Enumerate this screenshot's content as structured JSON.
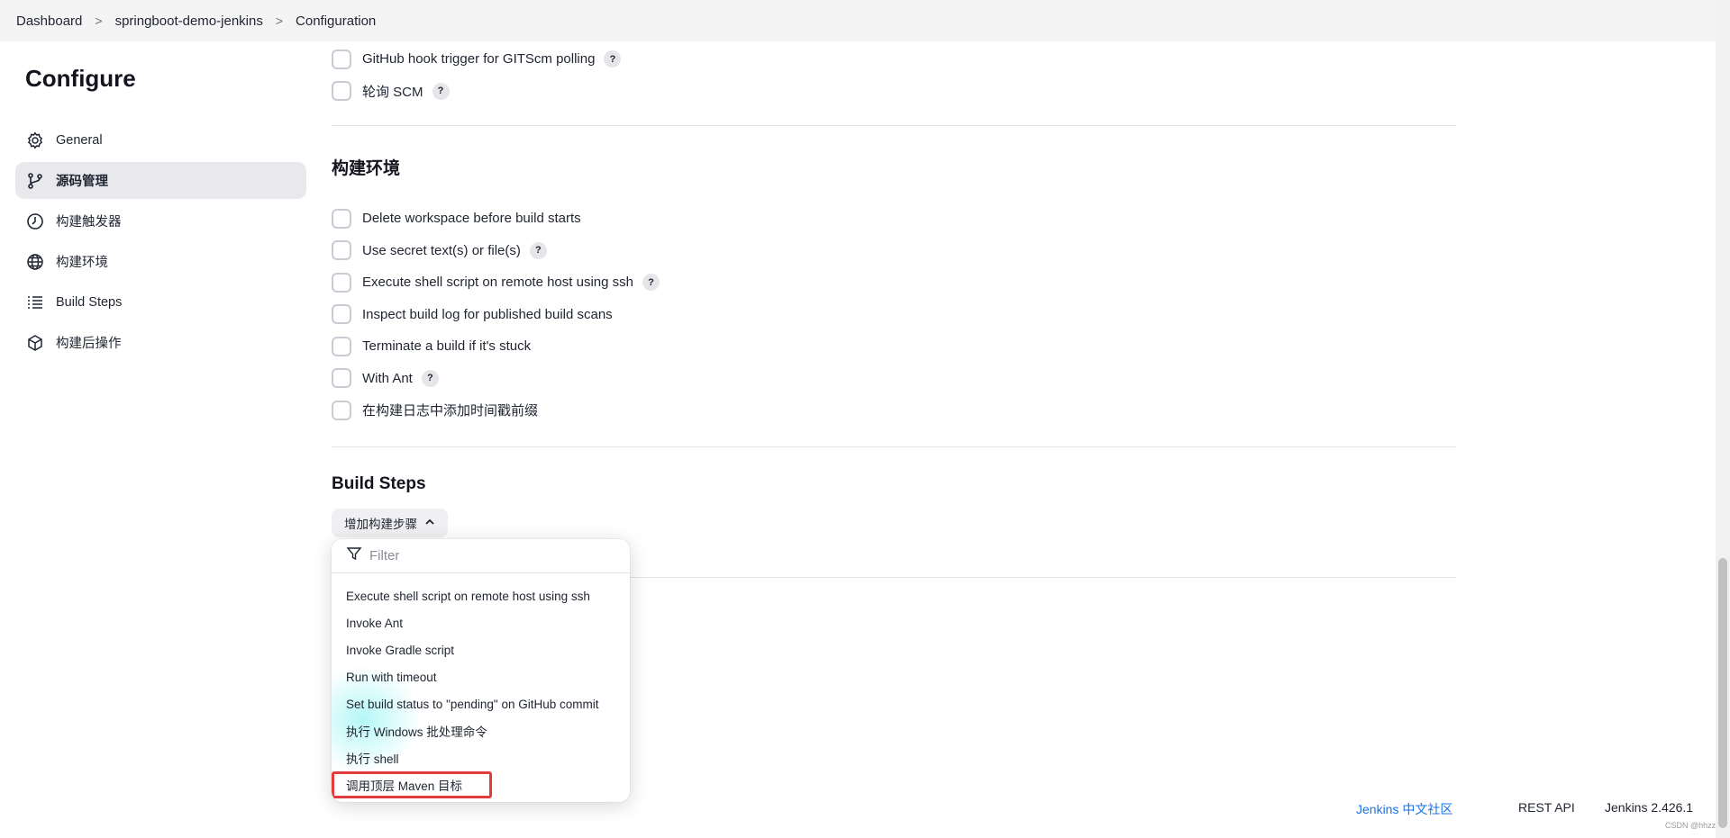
{
  "breadcrumb": {
    "items": [
      "Dashboard",
      "springboot-demo-jenkins",
      "Configuration"
    ],
    "separator": ">"
  },
  "sidebar": {
    "title": "Configure",
    "items": [
      {
        "label": "General",
        "icon": "gear-icon",
        "active": false
      },
      {
        "label": "源码管理",
        "icon": "branch-icon",
        "active": true
      },
      {
        "label": "构建触发器",
        "icon": "timer-icon",
        "active": false
      },
      {
        "label": "构建环境",
        "icon": "globe-icon",
        "active": false
      },
      {
        "label": "Build Steps",
        "icon": "list-icon",
        "active": false
      },
      {
        "label": "构建后操作",
        "icon": "cube-icon",
        "active": false
      }
    ]
  },
  "triggers": {
    "options": [
      {
        "label": "GitHub hook trigger for GITScm polling",
        "help": "?",
        "checked": false
      },
      {
        "label": "轮询 SCM",
        "help": "?",
        "checked": false
      }
    ]
  },
  "build_env": {
    "title": "构建环境",
    "options": [
      {
        "label": "Delete workspace before build starts",
        "help": "",
        "checked": false
      },
      {
        "label": "Use secret text(s) or file(s)",
        "help": "?",
        "checked": false
      },
      {
        "label": "Execute shell script on remote host using ssh",
        "help": "?",
        "checked": false
      },
      {
        "label": "Inspect build log for published build scans",
        "help": "",
        "checked": false
      },
      {
        "label": "Terminate a build if it's stuck",
        "help": "",
        "checked": false
      },
      {
        "label": "With Ant",
        "help": "?",
        "checked": false
      },
      {
        "label": "在构建日志中添加时间戳前缀",
        "help": "",
        "checked": false
      }
    ]
  },
  "build_steps": {
    "title": "Build Steps",
    "add_button": "增加构建步骤",
    "dropdown": {
      "filter_placeholder": "Filter",
      "items": [
        "Execute shell script on remote host using ssh",
        "Invoke Ant",
        "Invoke Gradle script",
        "Run with timeout",
        "Set build status to \"pending\" on GitHub commit",
        "执行 Windows 批处理命令",
        "执行 shell",
        "调用顶层 Maven 目标"
      ],
      "highlighted_item": "调用顶层 Maven 目标"
    }
  },
  "footer": {
    "community_link": "Jenkins 中文社区",
    "rest_api": "REST API",
    "version": "Jenkins 2.426.1"
  },
  "watermark": "CSDN @hhzz",
  "colors": {
    "highlight_border": "#e23b3b",
    "link": "#1a73e8",
    "active_nav_bg": "#e9e9ed"
  }
}
